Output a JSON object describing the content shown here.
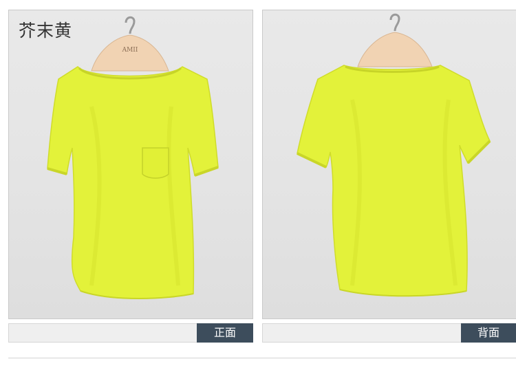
{
  "product": {
    "color_name": "芥末黄",
    "hanger_brand": "AMII",
    "garment_color": "#e3f23a"
  },
  "views": [
    {
      "label": "正面"
    },
    {
      "label": "背面"
    }
  ]
}
